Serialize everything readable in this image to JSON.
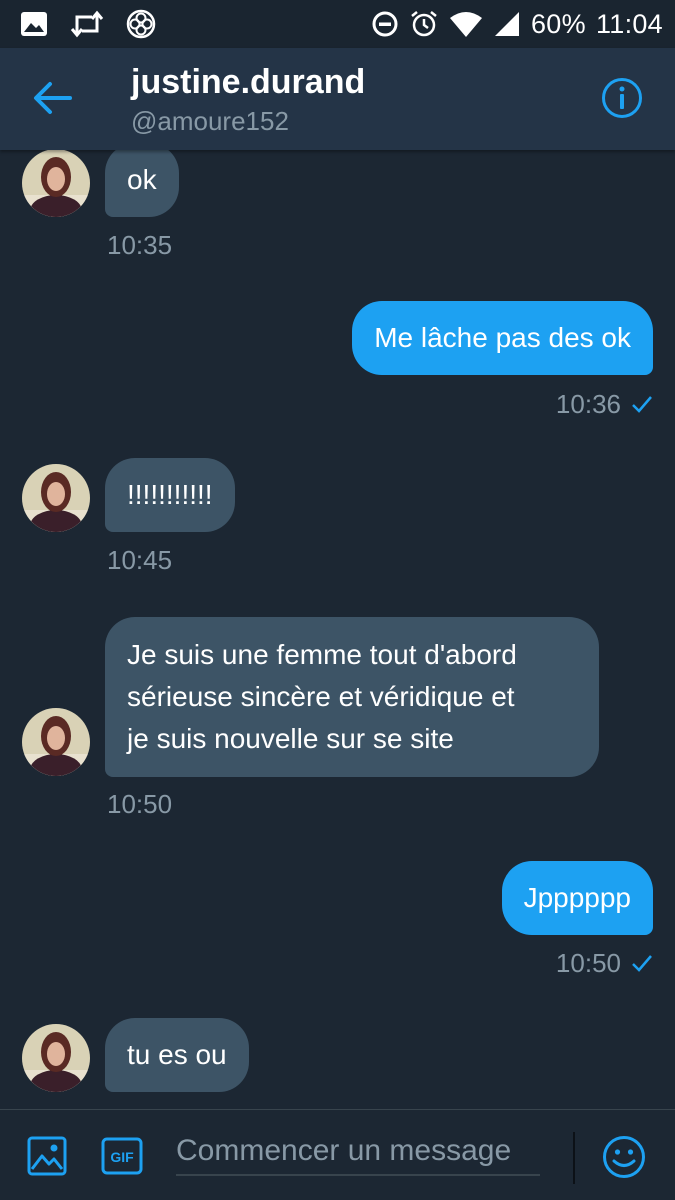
{
  "status_bar": {
    "icons_left": [
      "image-icon",
      "retweet-icon",
      "aperture-icon"
    ],
    "icons_right": [
      "do-not-disturb-icon",
      "alarm-icon",
      "wifi-icon",
      "signal-icon"
    ],
    "battery": "60%",
    "time": "11:04"
  },
  "header": {
    "title": "justine.durand",
    "handle": "@amoure152",
    "back_icon": "arrow-left-icon",
    "info_icon": "info-icon"
  },
  "messages": [
    {
      "direction": "incoming",
      "text": "ok",
      "time": "10:35"
    },
    {
      "direction": "outgoing",
      "text": "Me lâche pas des ok",
      "time": "10:36",
      "status": "✓"
    },
    {
      "direction": "incoming",
      "text": "!!!!!!!!!!!",
      "time": "10:45"
    },
    {
      "direction": "incoming",
      "lines": [
        "Je suis une femme tout d'abord",
        "sérieuse sincère et véridique  et",
        "je suis nouvelle sur se site"
      ],
      "time": "10:50"
    },
    {
      "direction": "outgoing",
      "text": "Jpppppp",
      "time": "10:50",
      "status": "✓"
    },
    {
      "direction": "incoming",
      "text": "tu es ou"
    }
  ],
  "composer": {
    "placeholder": "Commencer un message",
    "image_icon": "image-icon",
    "gif_label": "GIF",
    "emoji_icon": "emoji-icon"
  },
  "colors": {
    "background": "#1c2733",
    "header": "#243447",
    "incoming_bubble": "#3d5466",
    "outgoing_bubble": "#1da1f2",
    "accent": "#1da1f2",
    "muted_text": "#8899a6"
  }
}
